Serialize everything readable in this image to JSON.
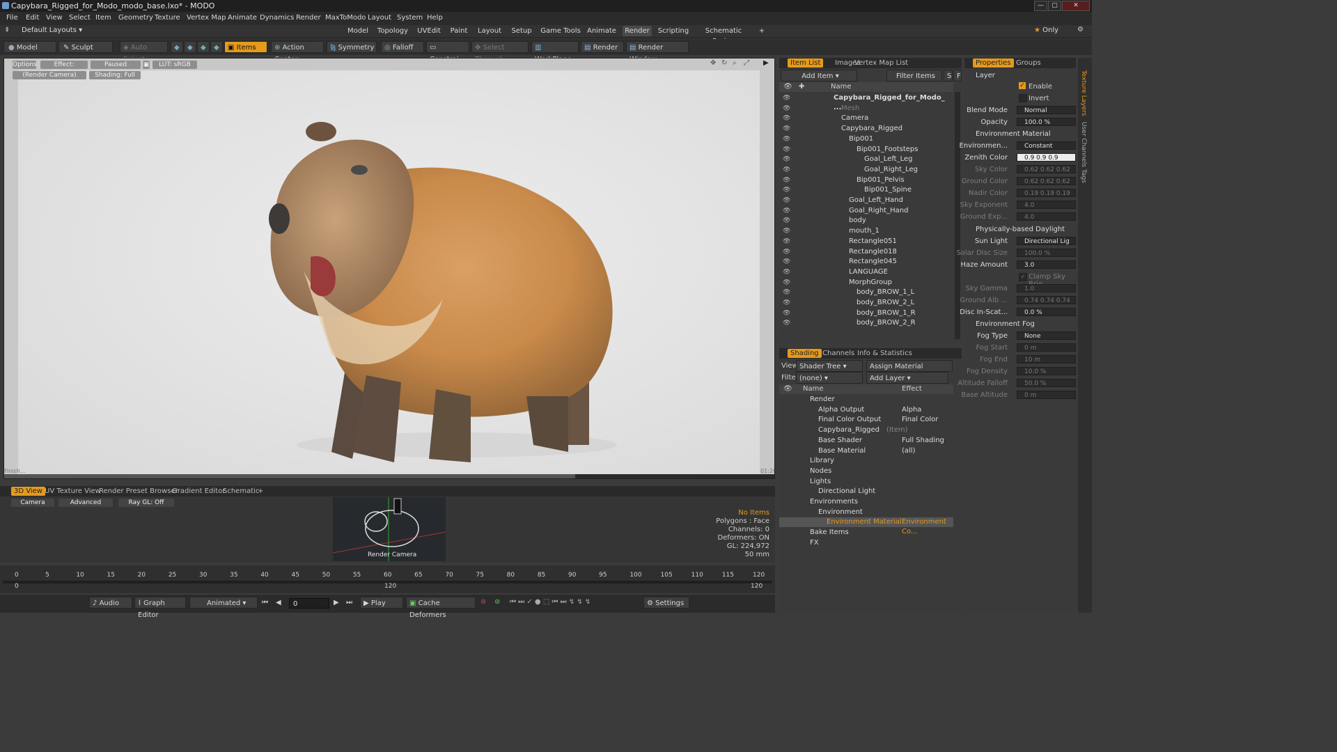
{
  "window": {
    "title": "Capybara_Rigged_for_Modo_modo_base.lxo* - MODO"
  },
  "menu": [
    "File",
    "Edit",
    "View",
    "Select",
    "Item",
    "Geometry",
    "Texture",
    "Vertex Map",
    "Animate",
    "Dynamics",
    "Render",
    "MaxToModo",
    "Layout",
    "System",
    "Help"
  ],
  "layout_bar": {
    "preset": "Default Layouts",
    "tabs": [
      "Model",
      "Topology",
      "UVEdit",
      "Paint",
      "Layout",
      "Setup",
      "Game Tools",
      "Animate",
      "Render",
      "Scripting",
      "Schematic Fusion"
    ],
    "active_tab": "Render",
    "only_label": "Only"
  },
  "toolbar": {
    "model": "Model",
    "sculpt": "Sculpt",
    "auto_select": "Auto Select",
    "items": "Items",
    "action_center": "Action Center",
    "symmetry": "Symmetry",
    "falloff": "Falloff",
    "constraints": "Constrai...",
    "select_through": "Select Through",
    "workplane": "WorkPlane",
    "render": "Render",
    "render_window": "Render Window"
  },
  "viewport": {
    "options": "Options",
    "effect": "Effect: (Shadi...",
    "paused": "Paused",
    "lut": "LUT: sRGB",
    "camera": "(Render Camera)",
    "shading": "Shading: Full",
    "finished": "Finish...",
    "time": "01:20"
  },
  "bottom_panel": {
    "tabs": [
      "3D View",
      "UV Texture View",
      "Render Preset Browser",
      "Gradient Editor",
      "Schematic"
    ],
    "active_tab": "3D View",
    "sub_buttons": [
      "Camera",
      "Advanced",
      "Ray GL: Off"
    ],
    "thumb_label": "Render Camera",
    "stats": [
      "No Items",
      "Polygons : Face",
      "Channels: 0",
      "Deformers: ON",
      "GL: 224,972",
      "50 mm"
    ]
  },
  "timeline": {
    "ticks": [
      "0",
      "5",
      "10",
      "15",
      "20",
      "25",
      "30",
      "35",
      "40",
      "45",
      "50",
      "55",
      "60",
      "65",
      "70",
      "75",
      "80",
      "85",
      "90",
      "95",
      "100",
      "105",
      "110",
      "115",
      "120"
    ],
    "range_start": "0",
    "range_mid": "120",
    "range_end": "120"
  },
  "transport": {
    "audio": "Audio",
    "graph_editor": "Graph Editor",
    "animated": "Animated",
    "frame": "0",
    "play": "Play",
    "cache": "Cache Deformers",
    "settings": "Settings"
  },
  "item_list": {
    "tabs": [
      "Item List",
      "Images",
      "Vertex Map List"
    ],
    "active_tab": "Item List",
    "add_item": "Add Item",
    "filter": "Filter Items",
    "s": "S",
    "f": "F",
    "col_name": "Name",
    "rows": [
      {
        "label": "Capybara_Rigged_for_Modo_ ...",
        "indent": 0,
        "bold": true
      },
      {
        "label": "Mesh",
        "indent": 1,
        "dim": true
      },
      {
        "label": "Camera",
        "indent": 1
      },
      {
        "label": "Capybara_Rigged",
        "indent": 1
      },
      {
        "label": "Bip001",
        "indent": 2
      },
      {
        "label": "Bip001_Footsteps",
        "indent": 3
      },
      {
        "label": "Goal_Left_Leg",
        "indent": 4
      },
      {
        "label": "Goal_Right_Leg",
        "indent": 4
      },
      {
        "label": "Bip001_Pelvis",
        "indent": 3
      },
      {
        "label": "Bip001_Spine",
        "indent": 4
      },
      {
        "label": "Goal_Left_Hand",
        "indent": 2
      },
      {
        "label": "Goal_Right_Hand",
        "indent": 2
      },
      {
        "label": "body",
        "indent": 2
      },
      {
        "label": "mouth_1",
        "indent": 2
      },
      {
        "label": "Rectangle051",
        "indent": 2
      },
      {
        "label": "Rectangle018",
        "indent": 2
      },
      {
        "label": "Rectangle045",
        "indent": 2
      },
      {
        "label": "LANGUAGE",
        "indent": 2
      },
      {
        "label": "MorphGroup",
        "indent": 2
      },
      {
        "label": "body_BROW_1_L",
        "indent": 3
      },
      {
        "label": "body_BROW_2_L",
        "indent": 3
      },
      {
        "label": "body_BROW_1_R",
        "indent": 3
      },
      {
        "label": "body_BROW_2_R",
        "indent": 3
      }
    ]
  },
  "shading": {
    "tabs": [
      "Shading",
      "Channels",
      "Info & Statistics"
    ],
    "active_tab": "Shading",
    "view_label": "View",
    "view_value": "Shader Tree",
    "assign_material": "Assign Material",
    "filter_label": "Filter",
    "filter_value": "(none)",
    "add_layer": "Add Layer",
    "col_name": "Name",
    "col_effect": "Effect",
    "rows": [
      {
        "label": "Render",
        "effect": "",
        "indent": 0
      },
      {
        "label": "Alpha Output",
        "effect": "Alpha",
        "indent": 1
      },
      {
        "label": "Final Color Output",
        "effect": "Final Color",
        "indent": 1
      },
      {
        "label": "Capybara_Rigged",
        "suffix": "(Item)",
        "effect": "",
        "indent": 1
      },
      {
        "label": "Base Shader",
        "effect": "Full Shading",
        "indent": 1
      },
      {
        "label": "Base Material",
        "effect": "(all)",
        "indent": 1
      },
      {
        "label": "Library",
        "effect": "",
        "indent": 0
      },
      {
        "label": "Nodes",
        "effect": "",
        "indent": 0
      },
      {
        "label": "Lights",
        "effect": "",
        "indent": 0
      },
      {
        "label": "Directional Light",
        "effect": "",
        "indent": 1
      },
      {
        "label": "Environments",
        "effect": "",
        "indent": 0
      },
      {
        "label": "Environment",
        "effect": "",
        "indent": 1
      },
      {
        "label": "Environment Material",
        "effect": "Environment Co...",
        "indent": 2,
        "selected": true
      },
      {
        "label": "Bake Items",
        "effect": "",
        "indent": 0
      },
      {
        "label": "FX",
        "effect": "",
        "indent": 0
      }
    ]
  },
  "properties": {
    "tabs": [
      "Properties",
      "Groups"
    ],
    "active_tab": "Properties",
    "layer": "Layer",
    "enable": "Enable",
    "invert": "Invert",
    "blend_mode_label": "Blend Mode",
    "blend_mode": "Normal",
    "opacity_label": "Opacity",
    "opacity": "100.0 %",
    "env_material_section": "Environment Material",
    "environment_label": "Environmen...",
    "environment": "Constant",
    "zenith_label": "Zenith Color",
    "zenith": "0.9  0.9  0.9",
    "sky_label": "Sky Color",
    "sky": "0.62 0.62 0.62",
    "ground_label": "Ground Color",
    "ground": "0.62 0.62 0.62",
    "nadir_label": "Nadir Color",
    "nadir": "0.19 0.19 0.19",
    "sky_exp_label": "Sky Exponent",
    "sky_exp": "4.0",
    "ground_exp_label": "Ground Exp...",
    "ground_exp": "4.0",
    "daylight_section": "Physically-based Daylight",
    "sun_light_label": "Sun Light",
    "sun_light": "Directional Lig ...",
    "solar_disc_label": "Solar Disc Size",
    "solar_disc": "100.0 %",
    "haze_label": "Haze Amount",
    "haze": "3.0",
    "clamp_sky": "Clamp Sky Brig...",
    "sky_gamma_label": "Sky Gamma",
    "sky_gamma": "1.0",
    "ground_alb_label": "Ground Alb ...",
    "ground_alb": "0.74 0.74 0.74",
    "disc_in_label": "Disc In-Scat...",
    "disc_in": "0.0 %",
    "fog_section": "Environment Fog",
    "fog_type_label": "Fog Type",
    "fog_type": "None",
    "fog_start_label": "Fog Start",
    "fog_start": "0 m",
    "fog_end_label": "Fog End",
    "fog_end": "10 m",
    "fog_density_label": "Fog Density",
    "fog_density": "10.0 %",
    "alt_falloff_label": "Altitude Falloff",
    "alt_falloff": "50.0 %",
    "base_alt_label": "Base Altitude",
    "base_alt": "0 m"
  },
  "side_tabs": [
    "Texture Layers",
    "User Channels",
    "Tags"
  ],
  "colors": {
    "accent": "#e59a1d",
    "panel": "#3a3a3a",
    "dark": "#2b2b2b"
  }
}
